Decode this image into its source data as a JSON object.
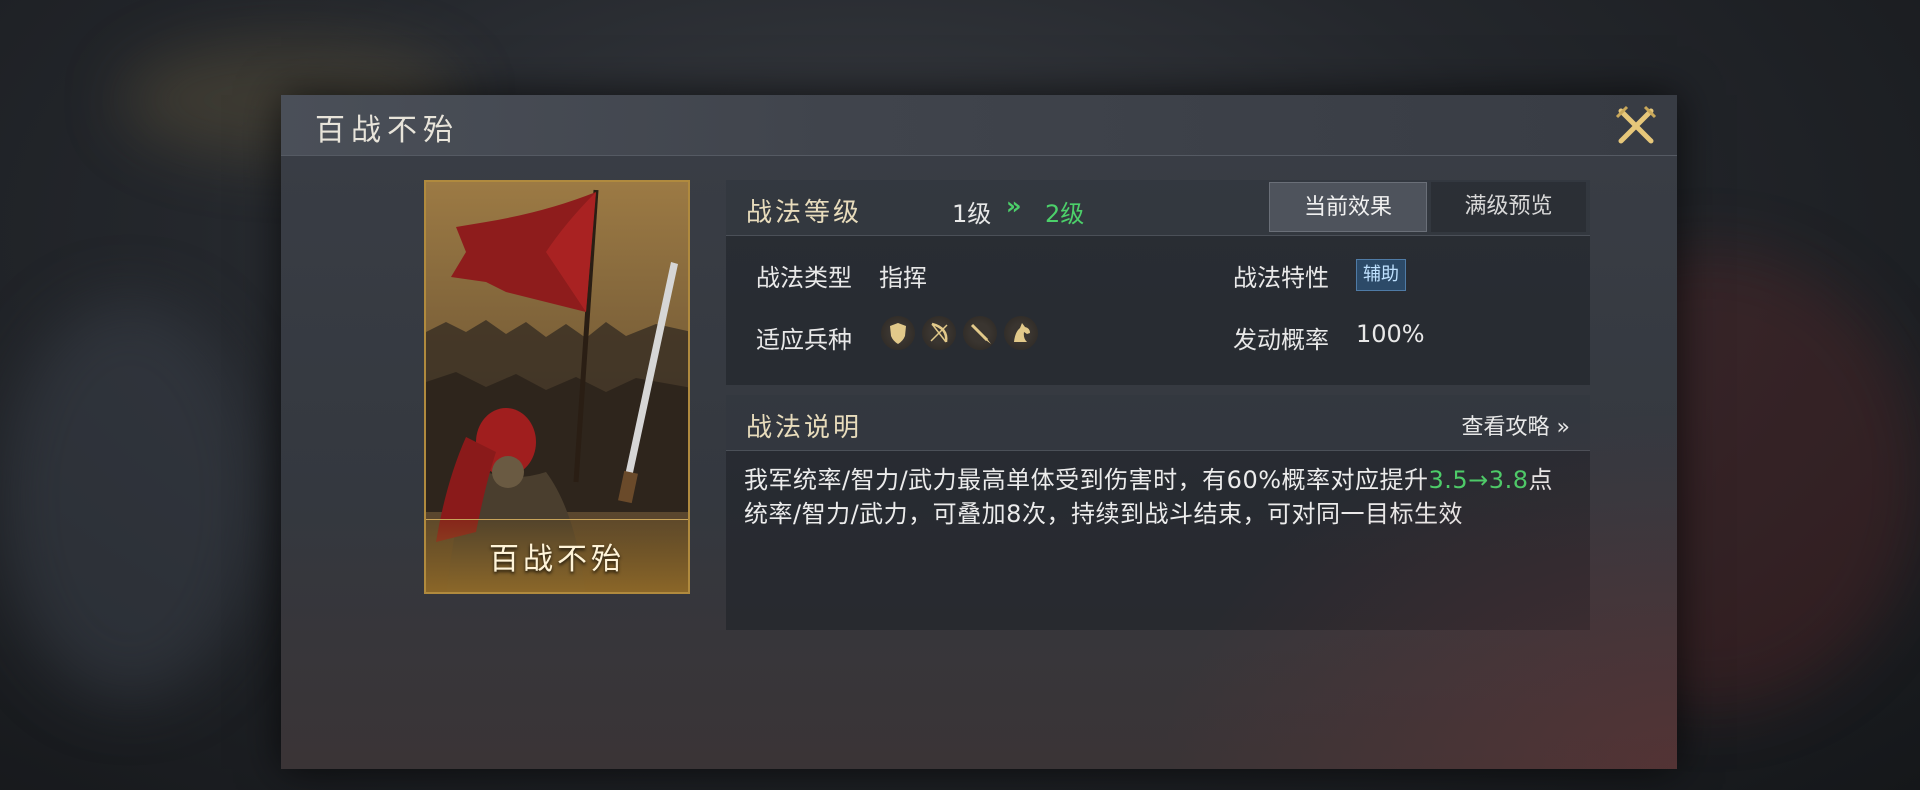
{
  "dialog": {
    "title": "百战不殆",
    "close_icon": "crossed-swords-close-icon"
  },
  "card": {
    "label": "百战不殆"
  },
  "level": {
    "label": "战法等级",
    "from": "1级",
    "arrow": "»",
    "to": "2级",
    "tabs": [
      {
        "label": "当前效果",
        "active": true
      },
      {
        "label": "满级预览",
        "active": false
      }
    ]
  },
  "info": {
    "type_label": "战法类型",
    "type_value": "指挥",
    "trait_label": "战法特性",
    "trait_value": "辅助",
    "troops_label": "适应兵种",
    "troop_icons": [
      "shield-icon",
      "bow-icon",
      "spear-icon",
      "horse-icon"
    ],
    "rate_label": "发动概率",
    "rate_value": "100%"
  },
  "description": {
    "title": "战法说明",
    "guide_link": "查看攻略 »",
    "text_before": "我军统率/智力/武力最高单体受到伤害时，有60%概率对应提升",
    "highlight": "3.5→3.8",
    "text_after": "点统率/智力/武力，可叠加8次，持续到战斗结束，可对同一目标生效"
  },
  "colors": {
    "accent_green": "#4cd06a",
    "card_border": "#b08a3e",
    "badge_bg": "#2c4a68"
  }
}
